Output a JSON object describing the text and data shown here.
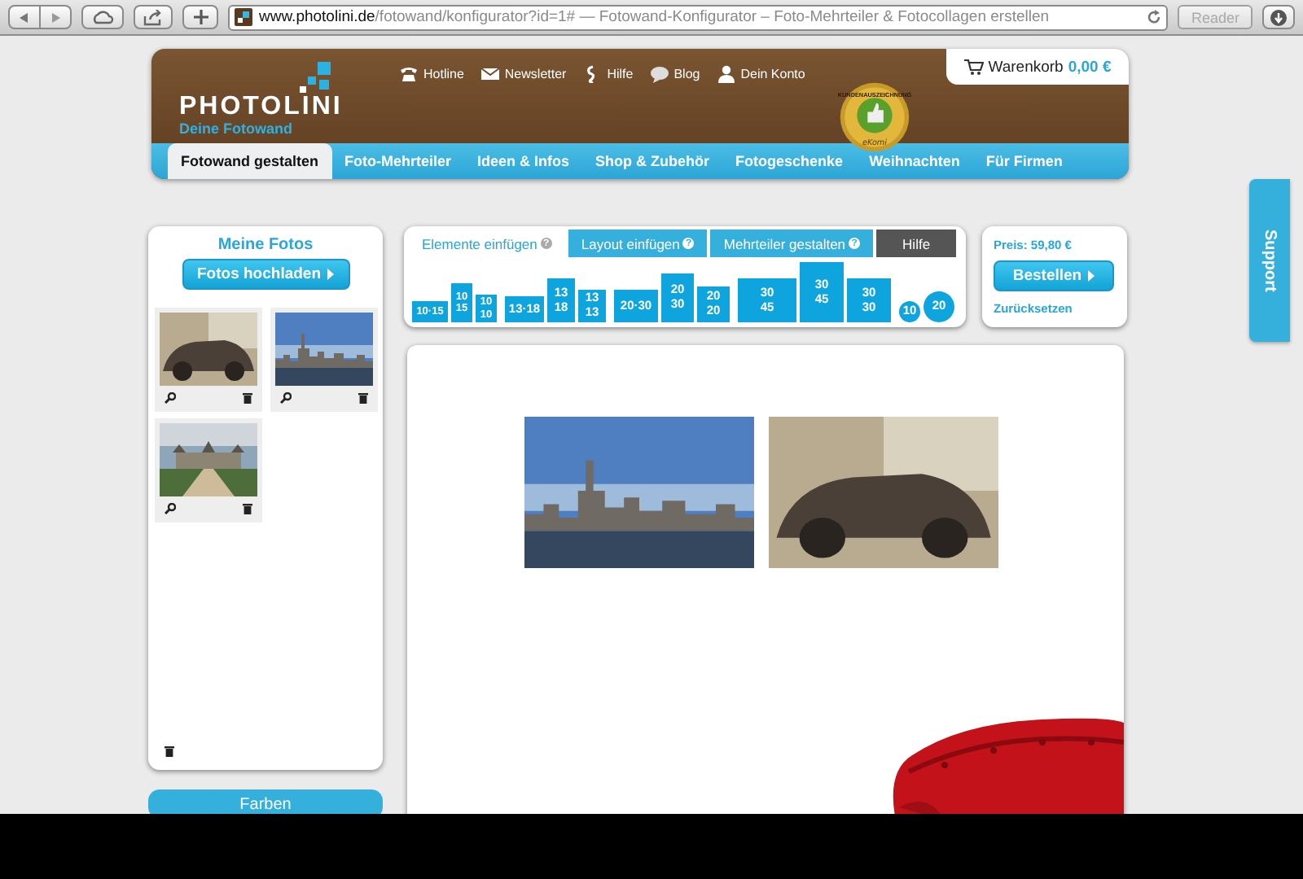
{
  "browser": {
    "url_host": "www.photolini.de",
    "url_path": "/fotowand/konfigurator?id=1#",
    "page_title": " — Fotowand-Konfigurator – Foto-Mehrteiler & Fotocollagen erstellen",
    "reader_button": "Reader"
  },
  "header": {
    "logo": "PHOTOLINI",
    "tagline": "Deine Fotowand",
    "top_links": [
      {
        "label": "Hotline"
      },
      {
        "label": "Newsletter"
      },
      {
        "label": "Hilfe"
      },
      {
        "label": "Blog"
      },
      {
        "label": "Dein Konto"
      }
    ],
    "seal": {
      "ring_text": "KUNDENAUSZEICHNUNG",
      "brand": "eKomi"
    },
    "cart": {
      "label": "Warenkorb",
      "amount": "0,00 €"
    },
    "nav": [
      {
        "label": "Fotowand gestalten",
        "selected": true
      },
      {
        "label": "Foto-Mehrteiler",
        "selected": false
      },
      {
        "label": "Ideen & Infos",
        "selected": false
      },
      {
        "label": "Shop & Zubehör",
        "selected": false
      },
      {
        "label": "Fotogeschenke",
        "selected": false
      },
      {
        "label": "Weihnachten",
        "selected": false
      },
      {
        "label": "Für Firmen",
        "selected": false
      }
    ]
  },
  "sidebar": {
    "title": "Meine Fotos",
    "upload_button": "Fotos hochladen",
    "photos": [
      {
        "kind": "car"
      },
      {
        "kind": "skyline"
      },
      {
        "kind": "castle"
      }
    ],
    "colors_button": "Farben"
  },
  "toolbox": {
    "tabs": [
      {
        "label": "Elemente einfügen",
        "hint": "?",
        "kind": "normal",
        "selected": true
      },
      {
        "label": "Layout einfügen",
        "hint": "?",
        "kind": "normal",
        "selected": false
      },
      {
        "label": "Mehrteiler gestalten",
        "hint": "?",
        "kind": "normal",
        "selected": false
      },
      {
        "label": "Hilfe",
        "kind": "help",
        "selected": false
      }
    ],
    "element_groups": [
      [
        {
          "kind": "wide",
          "lines": [
            "10·15"
          ]
        },
        {
          "kind": "tall",
          "lines": [
            "10",
            "15"
          ]
        },
        {
          "kind": "square",
          "lines": [
            "10",
            "10"
          ]
        }
      ],
      [
        {
          "kind": "wide",
          "lines": [
            "13·18"
          ]
        },
        {
          "kind": "tall",
          "lines": [
            "13",
            "18"
          ]
        },
        {
          "kind": "square",
          "lines": [
            "13",
            "13"
          ]
        }
      ],
      [
        {
          "kind": "wide",
          "lines": [
            "20·30"
          ]
        },
        {
          "kind": "tall",
          "lines": [
            "20",
            "30"
          ]
        },
        {
          "kind": "square",
          "lines": [
            "20",
            "20"
          ]
        }
      ],
      [
        {
          "kind": "wide",
          "lines": [
            "30",
            "45"
          ]
        },
        {
          "kind": "tall",
          "lines": [
            "30",
            "45"
          ]
        },
        {
          "kind": "square",
          "lines": [
            "30",
            "30"
          ]
        }
      ],
      [
        {
          "kind": "round",
          "lines": [
            "10"
          ]
        },
        {
          "kind": "round",
          "lines": [
            "20"
          ]
        }
      ]
    ]
  },
  "price": {
    "label": "Preis: 59,80 €",
    "order_button": "Bestellen",
    "reset_link": "Zurücksetzen"
  },
  "canvas": {
    "photos": [
      {
        "kind": "skyline"
      },
      {
        "kind": "car"
      }
    ],
    "armchair": true
  },
  "support_tab": "Support"
}
